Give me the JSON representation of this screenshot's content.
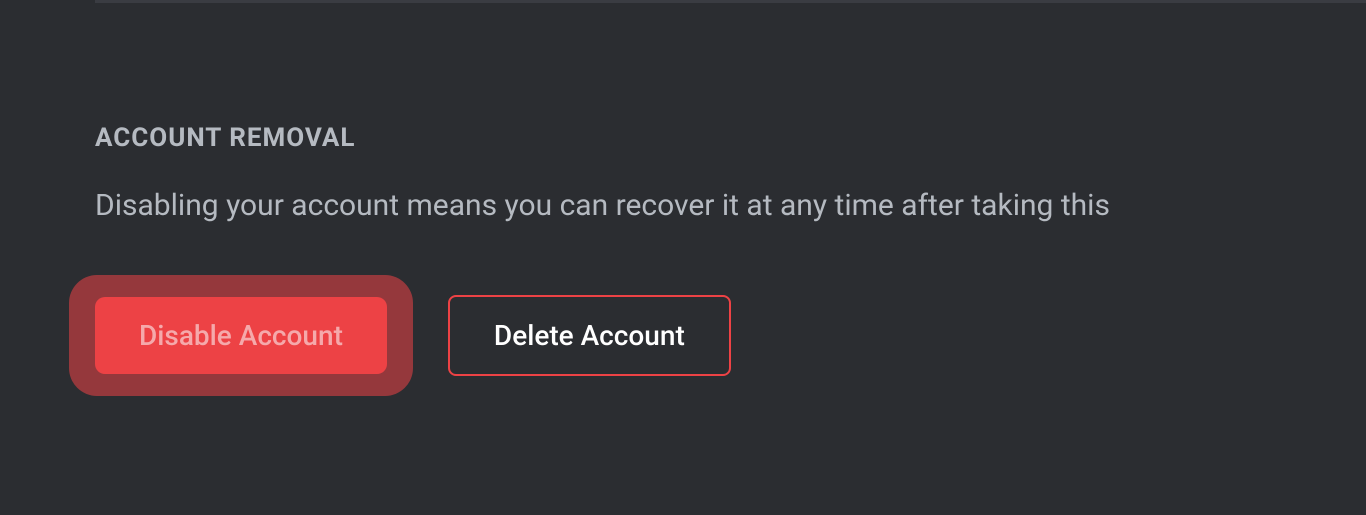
{
  "accountRemoval": {
    "sectionTitle": "ACCOUNT REMOVAL",
    "description": "Disabling your account means you can recover it at any time after taking this",
    "disableButtonLabel": "Disable Account",
    "deleteButtonLabel": "Delete Account"
  }
}
